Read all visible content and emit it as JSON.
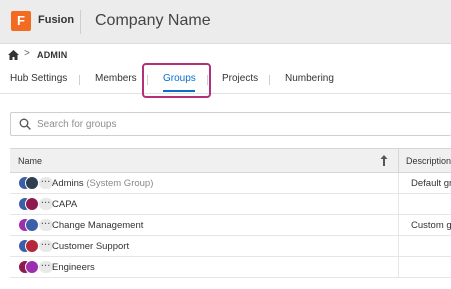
{
  "header": {
    "logo_letter": "F",
    "app_name": "Fusion",
    "company_name": "Company Name",
    "accent_color": "#f26b21"
  },
  "breadcrumb": {
    "separator": ">",
    "current": "ADMIN"
  },
  "tabs": [
    {
      "label": "Hub Settings",
      "active": false
    },
    {
      "label": "Members",
      "active": false
    },
    {
      "label": "Groups",
      "active": true
    },
    {
      "label": "Projects",
      "active": false
    },
    {
      "label": "Numbering",
      "active": false
    }
  ],
  "search": {
    "placeholder": "Search for groups",
    "value": ""
  },
  "table": {
    "columns": [
      {
        "label": "Name"
      },
      {
        "label": "Description"
      }
    ],
    "rows": [
      {
        "name": "Admins",
        "suffix": "(System Group)",
        "description": "Default group",
        "avatar_colors": [
          "#3a5fa8",
          "#2c3e50"
        ]
      },
      {
        "name": "CAPA",
        "suffix": "",
        "description": "",
        "avatar_colors": [
          "#3a5fa8",
          "#8e1b4e"
        ]
      },
      {
        "name": "Change Management",
        "suffix": "",
        "description": "Custom group",
        "avatar_colors": [
          "#9b2fae",
          "#3a5fa8"
        ]
      },
      {
        "name": "Customer Support",
        "suffix": "",
        "description": "",
        "avatar_colors": [
          "#3a5fa8",
          "#b5283a"
        ]
      },
      {
        "name": "Engineers",
        "suffix": "",
        "description": "",
        "avatar_colors": [
          "#8e1b4e",
          "#9b2fae"
        ]
      }
    ],
    "more_label": "···"
  }
}
